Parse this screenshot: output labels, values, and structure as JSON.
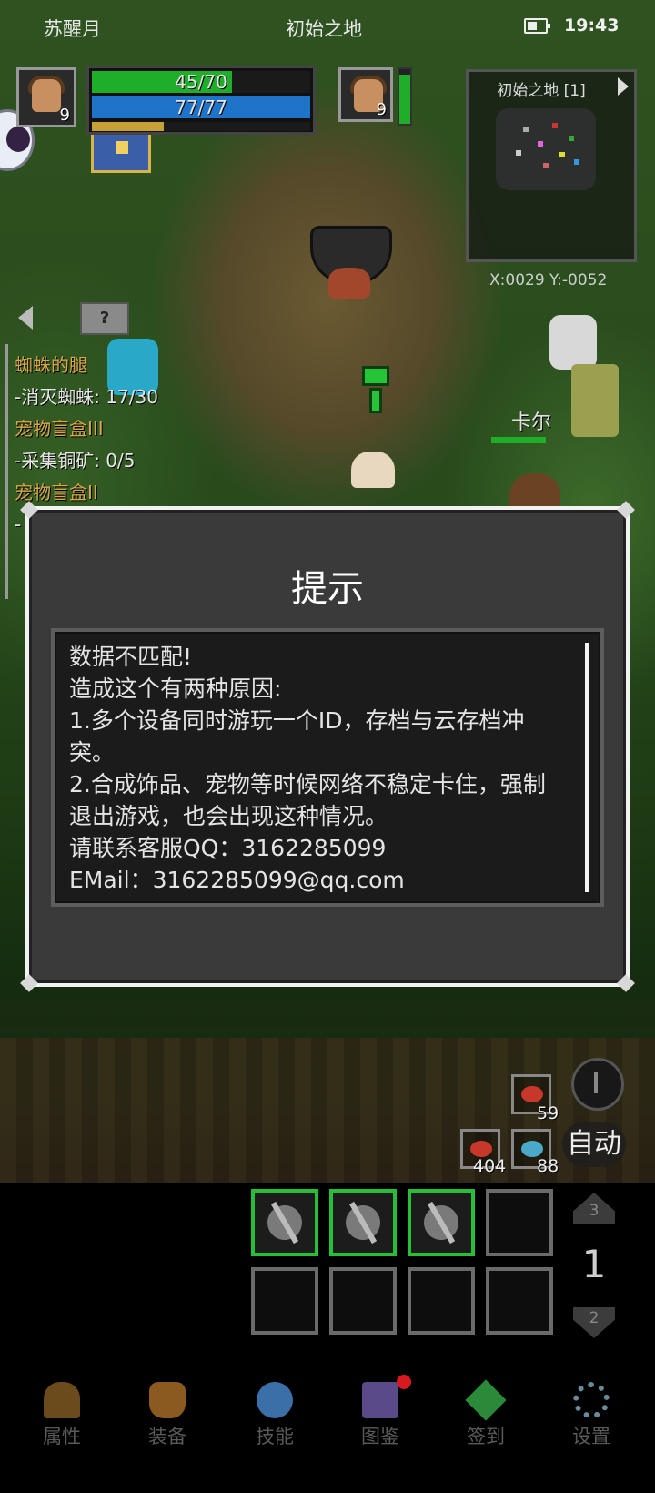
{
  "status_bar": {
    "left_text": "苏醒月",
    "center_text": "初始之地",
    "time": "19:43"
  },
  "player": {
    "level": "9",
    "hp_text": "45/70",
    "hp_fraction": 0.643,
    "mp_text": "77/77",
    "mp_fraction": 1.0,
    "xp_fraction": 0.33
  },
  "pet": {
    "level": "9",
    "hp_fraction": 0.9
  },
  "minimap": {
    "title": "初始之地 [1]",
    "coords": "X:0029  Y:-0052"
  },
  "quests": [
    {
      "title": "蜘蛛的腿",
      "task": "-消灭蜘蛛: 17/30"
    },
    {
      "title": "宠物盲盒III",
      "task": "-采集铜矿: 0/5"
    },
    {
      "title": "宠物盲盒II",
      "task": "-"
    }
  ],
  "npc": {
    "name": "卡尔"
  },
  "dialog": {
    "title": "提示",
    "message": "数据不匹配!\n造成这个有两种原因:\n1.多个设备同时游玩一个ID，存档与云存档冲突。\n2.合成饰品、宠物等时候网络不稳定卡住，强制退出游戏，也会出现这种情况。\n请联系客服QQ：3162285099\nEMail：3162285099@qq.com"
  },
  "items": [
    {
      "icon": "meat-icon",
      "count": "59",
      "color": "#c8382a"
    },
    {
      "icon": "meat-icon",
      "count": "404",
      "color": "#c8382a"
    },
    {
      "icon": "fish-icon",
      "count": "88",
      "color": "#4aa8c8"
    }
  ],
  "auto_button": "自动",
  "skill_page": {
    "up": "3",
    "current": "1",
    "down": "2"
  },
  "nav": [
    {
      "label": "属性",
      "icon": "helmet-icon",
      "color": "#6b4a1c"
    },
    {
      "label": "装备",
      "icon": "bag-icon",
      "color": "#8a5a20"
    },
    {
      "label": "技能",
      "icon": "crystal-icon",
      "color": "#3a6fa8"
    },
    {
      "label": "图鉴",
      "icon": "book-icon",
      "color": "#5a4a8a",
      "badge": true
    },
    {
      "label": "签到",
      "icon": "gem-icon",
      "color": "#2a8a3a"
    },
    {
      "label": "设置",
      "icon": "gear-icon",
      "color": "#5a7a8a"
    }
  ],
  "colors": {
    "hp": "#1fae2a",
    "mp": "#1e74c8",
    "xp": "#c8a038",
    "quest_title": "#d9a84a",
    "skill_border_active": "#26c038",
    "badge": "#d71920"
  }
}
